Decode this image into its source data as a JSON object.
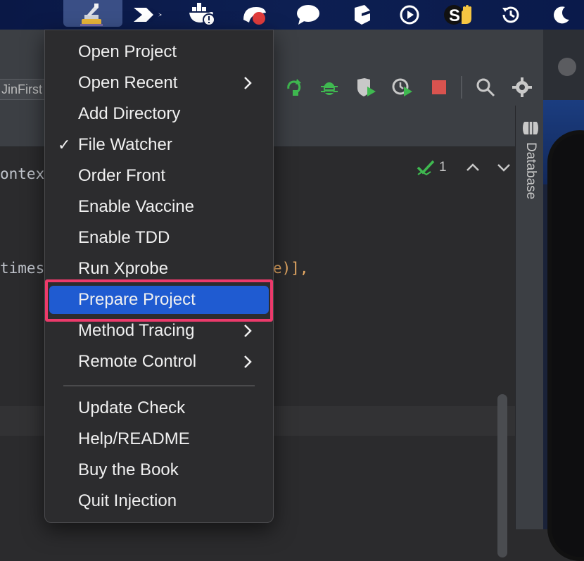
{
  "menubar": {
    "icons": [
      "injection-app-icon",
      "swift-bird-icon",
      "docker-whale-icon",
      "gif-capture-icon",
      "chat-bubble-icon",
      "cube-app-icon",
      "play-circle-icon",
      "hand-stop-icon",
      "time-machine-icon",
      "moon-icon"
    ]
  },
  "ide": {
    "run_config": "JinFirst",
    "code": {
      "line1": "ontex",
      "line2_left": "times",
      "line2_right": "e)],"
    },
    "inspections": {
      "count": "1"
    },
    "right_panel": {
      "database_label": "Database"
    }
  },
  "menu": {
    "items": [
      {
        "label": "Open Project",
        "submenu": false,
        "checked": false
      },
      {
        "label": "Open Recent",
        "submenu": true,
        "checked": false
      },
      {
        "label": "Add Directory",
        "submenu": false,
        "checked": false
      },
      {
        "label": "File Watcher",
        "submenu": false,
        "checked": true
      },
      {
        "label": "Order Front",
        "submenu": false,
        "checked": false
      },
      {
        "label": "Enable Vaccine",
        "submenu": false,
        "checked": false
      },
      {
        "label": "Enable TDD",
        "submenu": false,
        "checked": false
      },
      {
        "label": "Run Xprobe",
        "submenu": false,
        "checked": false
      },
      {
        "label": "Prepare Project",
        "submenu": false,
        "checked": false,
        "selected": true
      },
      {
        "label": "Method Tracing",
        "submenu": true,
        "checked": false
      },
      {
        "label": "Remote Control",
        "submenu": true,
        "checked": false
      },
      {
        "label": "Update Check",
        "submenu": false,
        "checked": false
      },
      {
        "label": "Help/README",
        "submenu": false,
        "checked": false
      },
      {
        "label": "Buy the Book",
        "submenu": false,
        "checked": false
      },
      {
        "label": "Quit Injection",
        "submenu": false,
        "checked": false
      }
    ],
    "check_glyph": "✓"
  },
  "colors": {
    "selection": "#1f5bd1",
    "highlight_border": "#ec3a6b",
    "menubar": "#0b1a4a",
    "accent_green": "#3fb950",
    "stop_red": "#d9534f"
  }
}
